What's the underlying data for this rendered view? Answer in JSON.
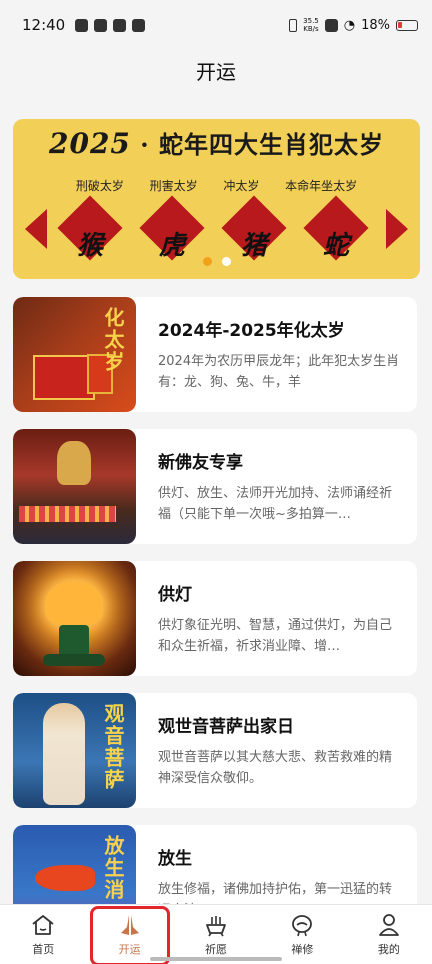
{
  "status_bar": {
    "time": "12:40",
    "net_speed_value": "35.5",
    "net_speed_unit": "KB/s",
    "battery": "18%"
  },
  "page": {
    "title": "开运"
  },
  "banner": {
    "year": "2025",
    "separator": "·",
    "title": "蛇年四大生肖犯太岁",
    "categories": [
      "刑破太岁",
      "刑害太岁",
      "冲太岁",
      "本命年坐太岁"
    ],
    "zodiacs": [
      "猴",
      "虎",
      "猪",
      "蛇"
    ],
    "active_slide": 0,
    "slide_count": 2
  },
  "items": [
    {
      "title": "2024年-2025年化太岁",
      "desc": "2024年为农历甲辰龙年；此年犯太岁生肖有：龙、狗、兔、牛，羊",
      "thumb_text": "化太岁"
    },
    {
      "title": "新佛友专享",
      "desc": "供灯、放生、法师开光加持、法师诵经祈福（只能下单一次哦~多拍算一…",
      "thumb_text": ""
    },
    {
      "title": "供灯",
      "desc": "供灯象征光明、智慧，通过供灯，为自己和众生祈福，祈求消业障、增…",
      "thumb_text": ""
    },
    {
      "title": "观世音菩萨出家日",
      "desc": "观世音菩萨以其大慈大悲、救苦救难的精神深受信众敬仰。",
      "thumb_text": "观音菩萨"
    },
    {
      "title": "放生",
      "desc": "放生修福，诸佛加持护佑，第一迅猛的转运方法",
      "thumb_text": "放生消"
    }
  ],
  "tabbar": {
    "active_index": 1,
    "tabs": [
      {
        "label": "首页",
        "icon": "home-icon"
      },
      {
        "label": "开运",
        "icon": "praying-hands-icon"
      },
      {
        "label": "祈愿",
        "icon": "incense-burner-icon"
      },
      {
        "label": "禅修",
        "icon": "meditation-icon"
      },
      {
        "label": "我的",
        "icon": "user-icon"
      }
    ]
  },
  "colors": {
    "accent": "#c8754a",
    "banner_bg": "#f2cf57",
    "banner_red": "#b8191c",
    "highlight": "#e3262a"
  }
}
